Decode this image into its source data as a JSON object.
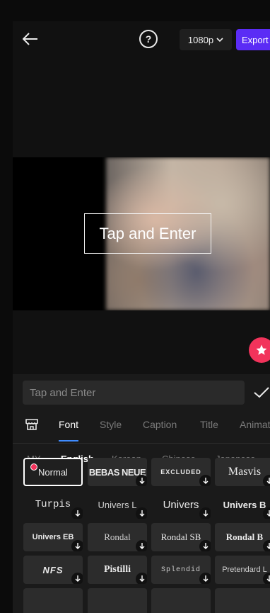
{
  "header": {
    "resolution": "1080p",
    "export_label": "Export"
  },
  "preview": {
    "overlay_text": "Tap and Enter"
  },
  "editor": {
    "input_placeholder": "Tap and Enter"
  },
  "tabs": [
    {
      "label": "Font",
      "active": true
    },
    {
      "label": "Style",
      "active": false
    },
    {
      "label": "Caption",
      "active": false
    },
    {
      "label": "Title",
      "active": false
    },
    {
      "label": "Animati",
      "active": false
    }
  ],
  "languages": [
    {
      "label": "MY",
      "active": false
    },
    {
      "label": "English",
      "active": true
    },
    {
      "label": "Korean",
      "active": false
    },
    {
      "label": "Chinese",
      "active": false
    },
    {
      "label": "Japanese",
      "active": false
    }
  ],
  "fonts": [
    {
      "label": "Normal",
      "selected": true,
      "downloadable": false,
      "is_new": true
    },
    {
      "label": "BEBAS NEUE",
      "selected": false,
      "downloadable": true
    },
    {
      "label": "EXCLUDED",
      "selected": false,
      "downloadable": true
    },
    {
      "label": "Masvis",
      "selected": false,
      "downloadable": true
    },
    {
      "label": "Turpis",
      "selected": false,
      "downloadable": true
    },
    {
      "label": "Univers L",
      "selected": false,
      "downloadable": true
    },
    {
      "label": "Univers",
      "selected": false,
      "downloadable": true
    },
    {
      "label": "Univers B",
      "selected": false,
      "downloadable": true
    },
    {
      "label": "Univers EB",
      "selected": false,
      "downloadable": true
    },
    {
      "label": "Rondal",
      "selected": false,
      "downloadable": true
    },
    {
      "label": "Rondal SB",
      "selected": false,
      "downloadable": true
    },
    {
      "label": "Rondal B",
      "selected": false,
      "downloadable": true
    },
    {
      "label": "NFS",
      "selected": false,
      "downloadable": true
    },
    {
      "label": "Pistilli",
      "selected": false,
      "downloadable": true
    },
    {
      "label": "Splendid",
      "selected": false,
      "downloadable": true
    },
    {
      "label": "Pretendard L",
      "selected": false,
      "downloadable": true
    }
  ],
  "colors": {
    "accent": "#5b2cf5",
    "tab_indicator": "#3f8cff",
    "favorite": "#f2335b"
  },
  "icons": {
    "back": "arrow-left-icon",
    "help": "question-circle-icon",
    "dropdown": "chevron-down-icon",
    "favorite": "star-icon",
    "confirm": "check-icon",
    "store": "store-icon",
    "download": "download-arrow-icon"
  }
}
